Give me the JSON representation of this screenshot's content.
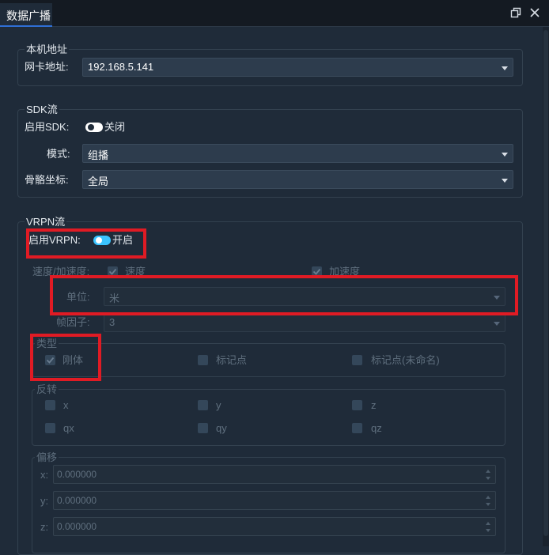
{
  "panel": {
    "title": "数据广播"
  },
  "local": {
    "legend": "本机地址",
    "nic_label": "网卡地址:",
    "nic_value": "192.168.5.141"
  },
  "sdk": {
    "legend": "SDK流",
    "enable_label": "启用SDK:",
    "enable_state": "关闭",
    "mode_label": "模式:",
    "mode_value": "组播",
    "skeleton_label": "骨骼坐标:",
    "skeleton_value": "全局"
  },
  "vrpn": {
    "legend": "VRPN流",
    "enable_label": "启用VRPN:",
    "enable_state": "开启",
    "velacc_label": "速度/加速度:",
    "velocity_label": "速度",
    "acceleration_label": "加速度",
    "unit_label": "单位:",
    "unit_value": "米",
    "frame_factor_label": "帧因子:",
    "frame_factor_value": "3",
    "type": {
      "legend": "类型",
      "rigid": "刚体",
      "marker": "标记点",
      "marker_unnamed": "标记点(未命名)"
    },
    "invert": {
      "legend": "反转",
      "x": "x",
      "y": "y",
      "z": "z",
      "qx": "qx",
      "qy": "qy",
      "qz": "qz"
    },
    "offset": {
      "legend": "偏移",
      "x_label": "x:",
      "x_value": "0.000000",
      "y_label": "y:",
      "y_value": "0.000000",
      "z_label": "z:",
      "z_value": "0.000000"
    }
  },
  "colors": {
    "accent": "#2f6fd6",
    "highlight": "#e01b24",
    "toggle_on": "#3ac4ff",
    "background": "#1f2b39"
  }
}
